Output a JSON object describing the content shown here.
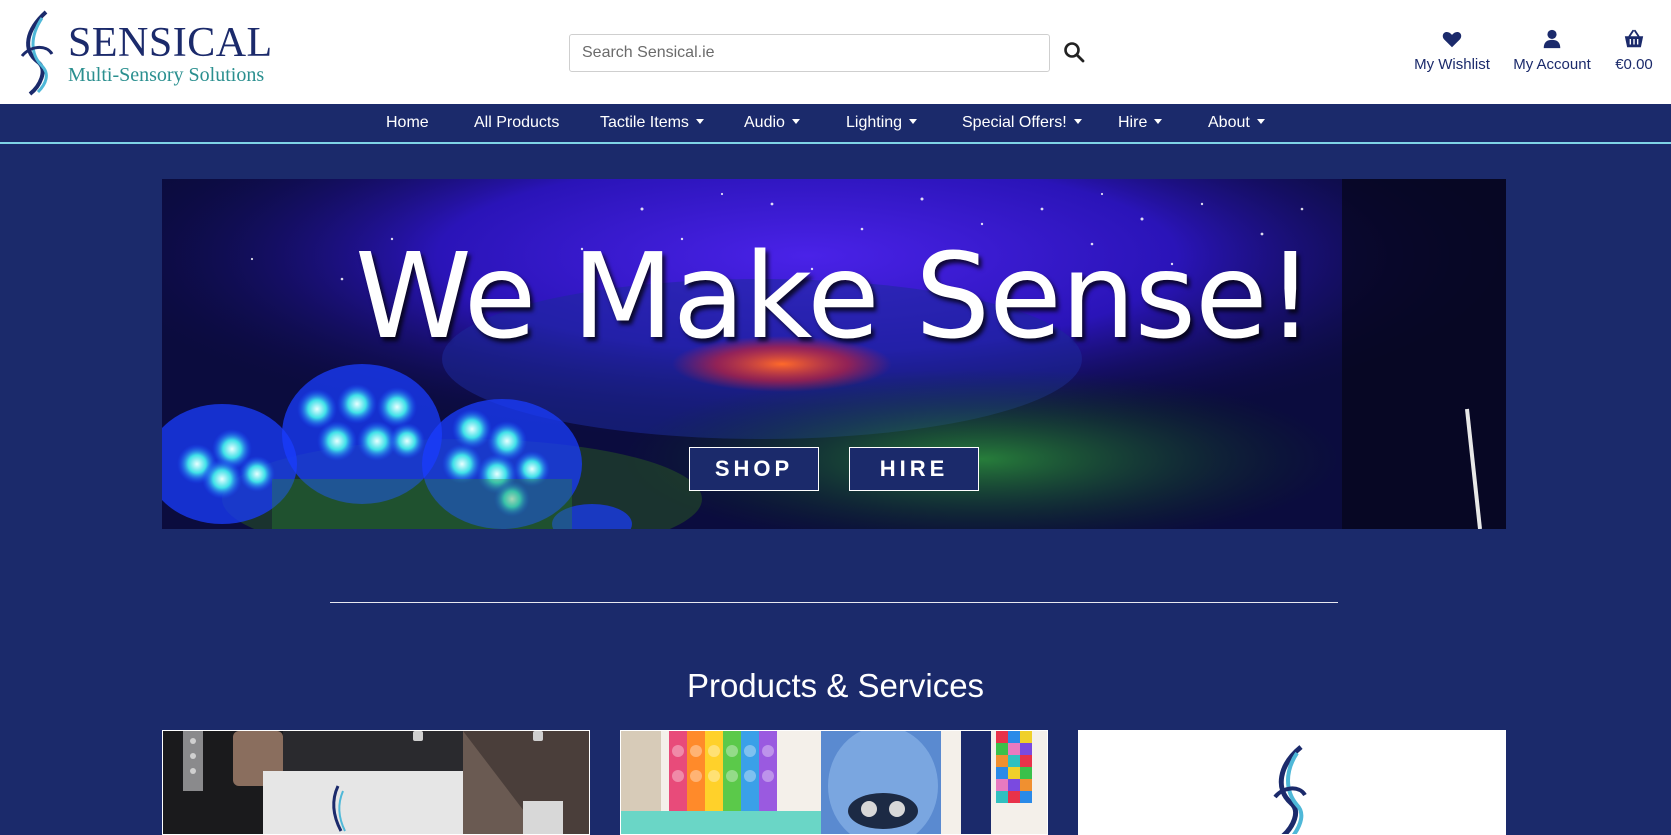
{
  "brand": {
    "name": "SENSICAL",
    "tagline": "Multi-Sensory Solutions",
    "logo_icon": "sensical-swirl-logo",
    "primary_color": "#1b2a6b",
    "accent_color": "#2a8f8f"
  },
  "search": {
    "placeholder": "Search Sensical.ie",
    "icon": "search-icon"
  },
  "header_links": {
    "wishlist": {
      "label": "My Wishlist",
      "icon": "heart-icon"
    },
    "account": {
      "label": "My Account",
      "icon": "user-icon"
    },
    "cart": {
      "label": "€0.00",
      "icon": "basket-icon"
    }
  },
  "nav": {
    "items": [
      {
        "label": "Home",
        "dropdown": false
      },
      {
        "label": "All Products",
        "dropdown": false
      },
      {
        "label": "Tactile Items",
        "dropdown": true
      },
      {
        "label": "Audio",
        "dropdown": true
      },
      {
        "label": "Lighting",
        "dropdown": true
      },
      {
        "label": "Special Offers!",
        "dropdown": true
      },
      {
        "label": "Hire",
        "dropdown": true
      },
      {
        "label": "About",
        "dropdown": true
      }
    ]
  },
  "hero": {
    "title": "We Make Sense!",
    "shop_label": "SHOP",
    "hire_label": "HIRE"
  },
  "sections": {
    "products_title": "Products & Services"
  }
}
